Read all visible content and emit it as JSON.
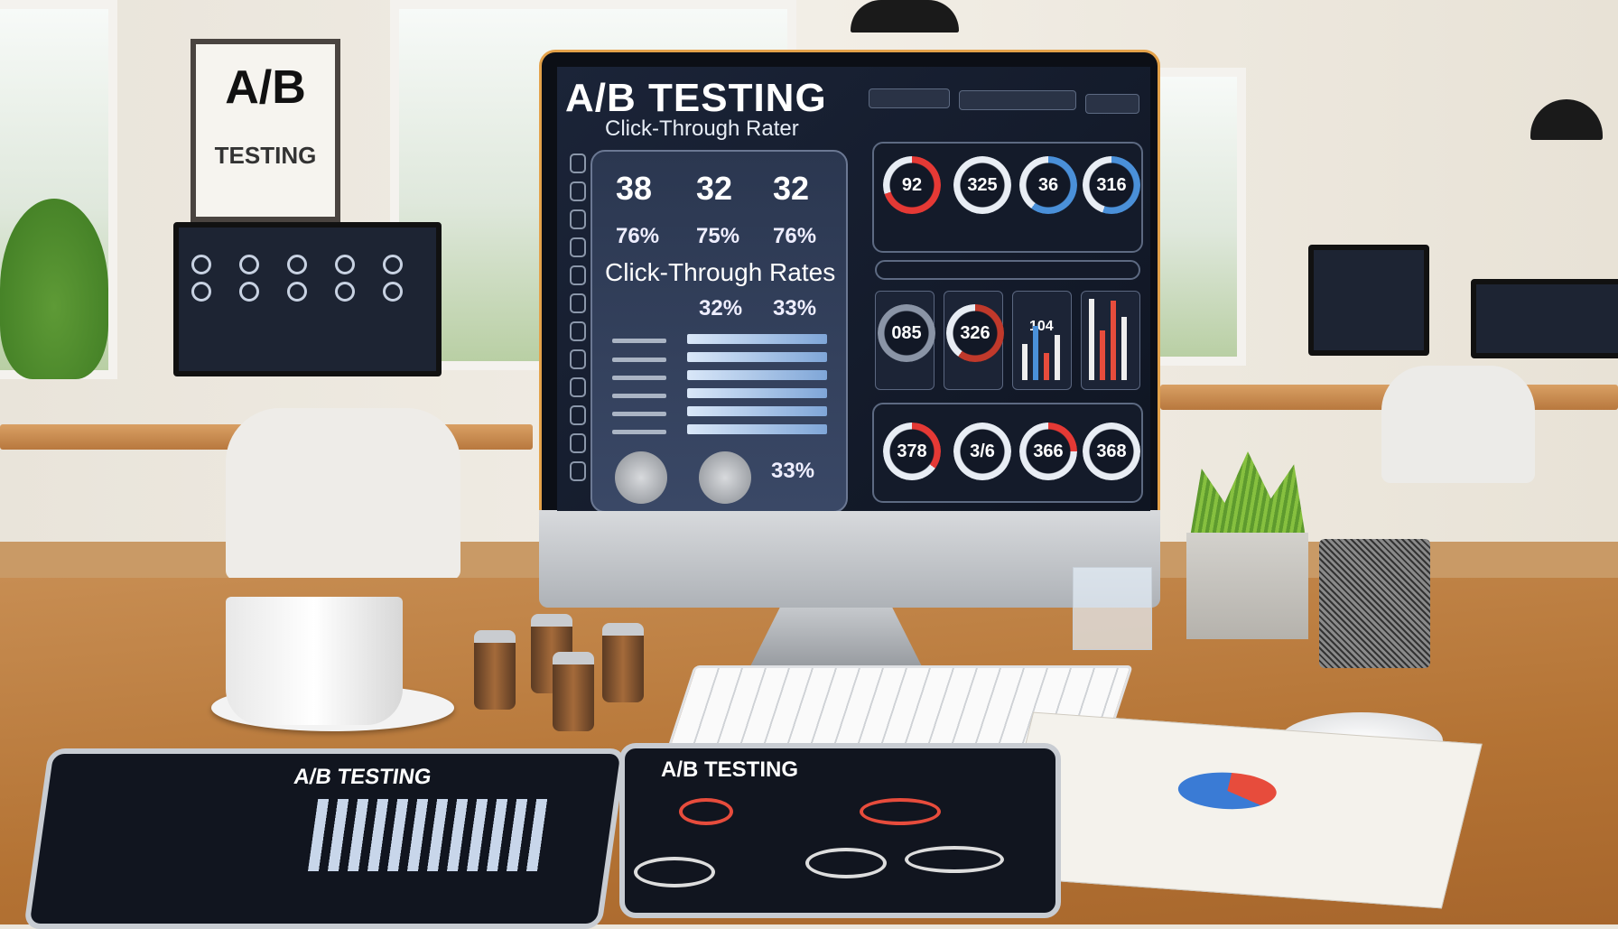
{
  "poster": {
    "line1": "A/B",
    "line2": "TESTING"
  },
  "monitor": {
    "title": "A/B TESTING",
    "subtitle": "Click-Through Rater",
    "top_numbers": [
      "38",
      "32",
      "32"
    ],
    "top_percents": [
      "76%",
      "75%",
      "76%"
    ],
    "section_title": "Click-Through Rates",
    "column_values": [
      "32%",
      "33%"
    ],
    "bar_fills": [
      100,
      100,
      100,
      100,
      100,
      100
    ],
    "summary_value": "33%",
    "gauges_row1": [
      {
        "value": "92",
        "fill": 70,
        "color": "#e53935"
      },
      {
        "value": "325",
        "fill": 100,
        "color": "#e8edf4"
      },
      {
        "value": "36",
        "fill": 60,
        "color": "#4a90d9"
      },
      {
        "value": "316",
        "fill": 55,
        "color": "#4a90d9"
      }
    ],
    "gauges_row2": [
      "085",
      "326",
      "104"
    ],
    "gauges_row3": [
      {
        "value": "378",
        "fill": 35,
        "color": "#e53935"
      },
      {
        "value": "3/6",
        "fill": 100,
        "color": "#e8edf4"
      },
      {
        "value": "366",
        "fill": 25,
        "color": "#e53935"
      },
      {
        "value": "368",
        "fill": 100,
        "color": "#e8edf4"
      }
    ]
  },
  "tablet_left": {
    "title": "A/B TESTING"
  },
  "tablet_middle": {
    "title": "A/B TESTING"
  }
}
